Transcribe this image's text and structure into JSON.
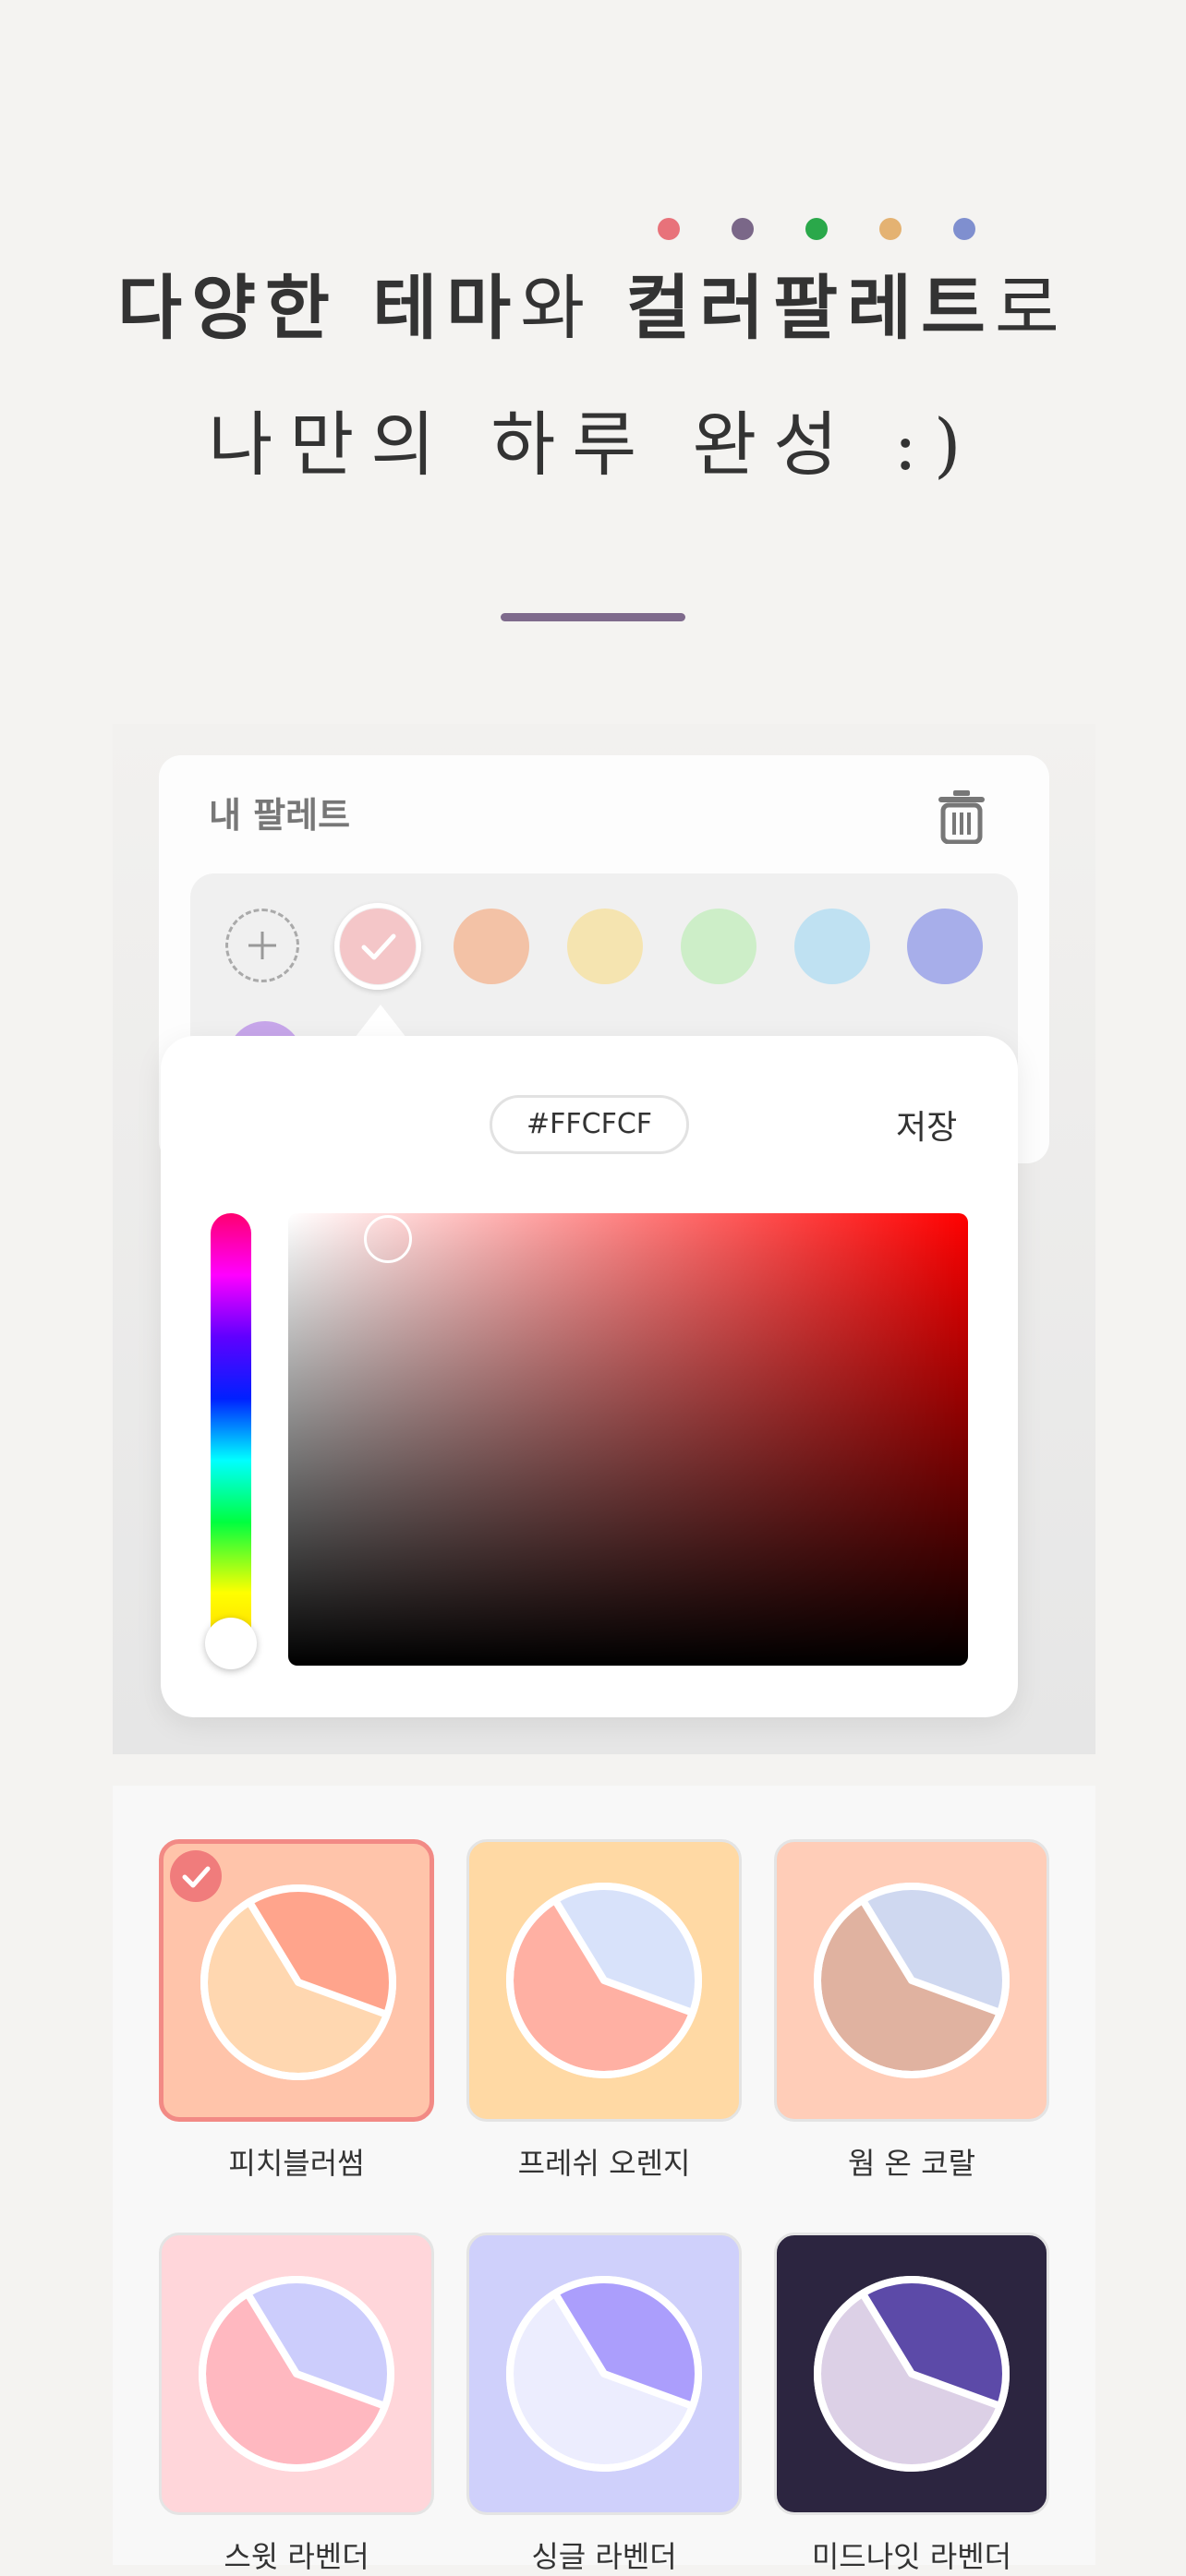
{
  "header": {
    "dots": [
      "#e8727a",
      "#7a6788",
      "#2aa84a",
      "#e4b272",
      "#7f8fcf"
    ],
    "line1": {
      "part1": "다양한 테마",
      "part2": "와 ",
      "part3": "컬러팔레트",
      "part4": "로"
    },
    "line2": "나만의 하루 완성 :)"
  },
  "palette": {
    "title": "내 팔레트",
    "add_label": "+",
    "swatches": [
      "#f4c6c8",
      "#f3c2a6",
      "#f5e4b0",
      "#cdeec8",
      "#bfe1f2",
      "#a7aeea",
      "#c7a6ea"
    ],
    "selected_index": 0
  },
  "picker": {
    "hex_value": "#FFCFCF",
    "save_label": "저장",
    "hue_color": "#ff0000"
  },
  "themes": [
    {
      "label": "피치블러썸",
      "bg": "#ffc4aa",
      "slice": "#ffa48c",
      "rest": "#ffd7b0",
      "selected": true
    },
    {
      "label": "프레쉬 오렌지",
      "bg": "#ffd9a4",
      "slice": "#d8e2fa",
      "rest": "#ffb0a3",
      "selected": false
    },
    {
      "label": "웜 온 코랄",
      "bg": "#ffcdb8",
      "slice": "#cfd8f0",
      "rest": "#e0b2a0",
      "selected": false
    },
    {
      "label": "스윗 라벤더",
      "bg": "#ffd6da",
      "slice": "#cccdfc",
      "rest": "#ffb8c0",
      "selected": false
    },
    {
      "label": "싱글 라벤더",
      "bg": "#cfd0fb",
      "slice": "#ab9efc",
      "rest": "#ecedfe",
      "selected": false
    },
    {
      "label": "미드나잇 라벤더",
      "bg": "#2c2540",
      "slice": "#5c4aa8",
      "rest": "#dcd0e6",
      "selected": false
    }
  ]
}
